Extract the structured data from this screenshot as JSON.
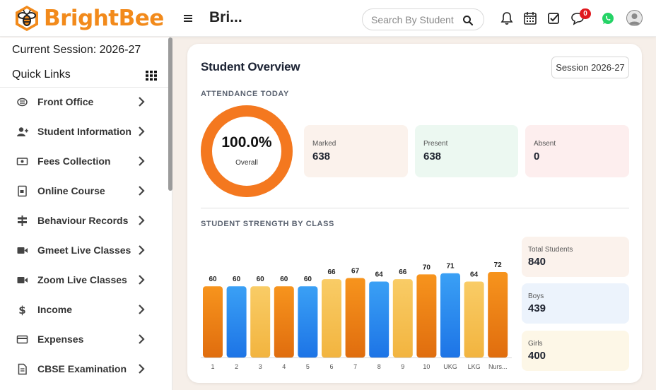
{
  "header": {
    "brand": "BrightBee",
    "page_title": "Bri...",
    "search_placeholder": "Search By Student",
    "message_count": "0",
    "icons": [
      "menu-icon",
      "search-icon",
      "bell-icon",
      "calendar-icon",
      "checkbox-icon",
      "chat-icon",
      "whatsapp-icon",
      "user-avatar"
    ]
  },
  "sidebar": {
    "session": "Current Session: 2026-27",
    "quick_links": "Quick Links",
    "items": [
      {
        "label": "Front Office",
        "icon": "front-office-icon"
      },
      {
        "label": "Student Information",
        "icon": "student-add-icon"
      },
      {
        "label": "Fees Collection",
        "icon": "money-icon"
      },
      {
        "label": "Online Course",
        "icon": "course-icon"
      },
      {
        "label": "Behaviour Records",
        "icon": "signpost-icon"
      },
      {
        "label": "Gmeet Live Classes",
        "icon": "video-icon"
      },
      {
        "label": "Zoom Live Classes",
        "icon": "video-icon"
      },
      {
        "label": "Income",
        "icon": "dollar-icon"
      },
      {
        "label": "Expenses",
        "icon": "credit-card-icon"
      },
      {
        "label": "CBSE Examination",
        "icon": "document-icon"
      }
    ]
  },
  "overview": {
    "title": "Student Overview",
    "session_button": "Session 2026-27",
    "attendance_label": "ATTENDANCE TODAY",
    "attendance_percent": "100.0%",
    "attendance_fraction": 1.0,
    "attendance_caption": "Overall",
    "stats": [
      {
        "label": "Marked",
        "value": "638"
      },
      {
        "label": "Present",
        "value": "638"
      },
      {
        "label": "Absent",
        "value": "0"
      }
    ],
    "strength_label": "STUDENT STRENGTH BY CLASS",
    "totals": [
      {
        "label": "Total Students",
        "value": "840"
      },
      {
        "label": "Boys",
        "value": "439"
      },
      {
        "label": "Girls",
        "value": "400"
      }
    ]
  },
  "colors": {
    "brand_orange": "#f28a1b",
    "donut_track": "#f4781f",
    "bar_orange": "#f08a1a",
    "bar_blue": "#2f8cf0",
    "bar_yellow": "#f7c556",
    "marked_bg": "#fbf2ec",
    "present_bg": "#ecf8f1",
    "absent_bg": "#fdeeee",
    "total_bg": "#fbf2ec",
    "boys_bg": "#ecf3fc",
    "girls_bg": "#fdf7e7"
  },
  "chart_data": {
    "type": "bar",
    "categories": [
      "1",
      "2",
      "3",
      "4",
      "5",
      "6",
      "7",
      "8",
      "9",
      "10",
      "UKG",
      "LKG",
      "Nurs..."
    ],
    "values": [
      60,
      60,
      60,
      60,
      60,
      66,
      67,
      64,
      66,
      70,
      71,
      64,
      72
    ],
    "bar_colors": [
      "orange",
      "blue",
      "yellow",
      "orange",
      "blue",
      "yellow",
      "orange",
      "blue",
      "yellow",
      "orange",
      "blue",
      "yellow",
      "orange"
    ],
    "title": "",
    "xlabel": "",
    "ylabel": "",
    "grid": false
  }
}
